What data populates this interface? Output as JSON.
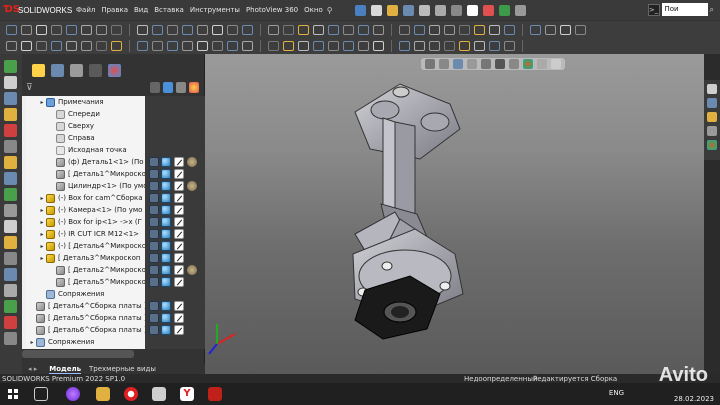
{
  "app": {
    "brand": "SOLIDWORKS",
    "menu": [
      "Файл",
      "Правка",
      "Вид",
      "Вставка",
      "Инструменты",
      "PhotoView 360",
      "Окно"
    ],
    "search_placeholder": "Пои"
  },
  "tree": {
    "rows": [
      {
        "label": "Примечания",
        "icon": "note",
        "indent": 1,
        "arrow": "▸"
      },
      {
        "label": "Спереди",
        "icon": "plane",
        "indent": 2,
        "arrow": ""
      },
      {
        "label": "Сверху",
        "icon": "plane",
        "indent": 2,
        "arrow": ""
      },
      {
        "label": "Справа",
        "icon": "plane",
        "indent": 2,
        "arrow": ""
      },
      {
        "label": "Исходная точка",
        "icon": "origin",
        "indent": 2,
        "arrow": ""
      },
      {
        "label": "(ф) Деталь1<1> (По ум",
        "icon": "part",
        "indent": 2,
        "arrow": ""
      },
      {
        "label": "[ Деталь1^Микроскоп",
        "icon": "part",
        "indent": 2,
        "arrow": ""
      },
      {
        "label": "Цилиндр<1> (По умол",
        "icon": "part",
        "indent": 2,
        "arrow": ""
      },
      {
        "label": "(-) Box for cam^Сборка",
        "icon": "asm",
        "indent": 1,
        "arrow": "▸"
      },
      {
        "label": "(-) Камера<1> (По умо",
        "icon": "asm",
        "indent": 1,
        "arrow": "▸"
      },
      {
        "label": "(-) Box for ip<1> ->x (Г",
        "icon": "asm",
        "indent": 1,
        "arrow": "▸"
      },
      {
        "label": "(-) IR CUT ICR M12<1>",
        "icon": "asm",
        "indent": 1,
        "arrow": "▸"
      },
      {
        "label": "(-) [ Деталь4^Микроскоп",
        "icon": "asm",
        "indent": 1,
        "arrow": "▸"
      },
      {
        "label": "[ Деталь3^Микроскоп",
        "icon": "asm",
        "indent": 1,
        "arrow": "▸"
      },
      {
        "label": "[ Деталь2^Микроскоп",
        "icon": "part",
        "indent": 2,
        "arrow": ""
      },
      {
        "label": "[ Деталь5^Микроскоп",
        "icon": "part",
        "indent": 2,
        "arrow": ""
      },
      {
        "label": "Сопряжения",
        "icon": "mate",
        "indent": 1,
        "arrow": ""
      },
      {
        "label": "[ Деталь4^Сборка платы ]<",
        "icon": "part",
        "indent": 0,
        "arrow": ""
      },
      {
        "label": "[ Деталь5^Сборка платы ]<",
        "icon": "part",
        "indent": 0,
        "arrow": ""
      },
      {
        "label": "[ Деталь6^Сборка платы ]<",
        "icon": "part",
        "indent": 0,
        "arrow": ""
      },
      {
        "label": "Сопряжения",
        "icon": "mate",
        "indent": 0,
        "arrow": "▸"
      }
    ]
  },
  "bottom_tabs": [
    "Модель",
    "Трехмерные виды"
  ],
  "status": {
    "version": "SOLIDWORKS Premium 2022 SP1.0",
    "state": "Недоопределенный",
    "edit_mode": "Редактируется Сборка"
  },
  "taskbar": {
    "lang": "ENG",
    "date": "28.02.2023"
  },
  "watermark": "Avito"
}
